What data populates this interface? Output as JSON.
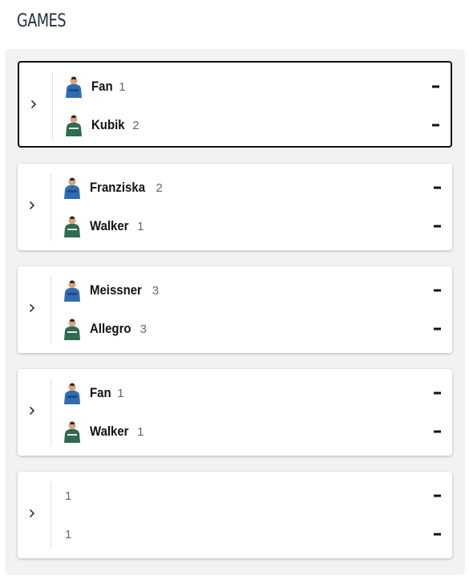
{
  "section": {
    "title": "GAMES"
  },
  "colors": {
    "team_blue": "#2f6db3",
    "team_green": "#2e6b4f"
  },
  "games": [
    {
      "selected": true,
      "home": {
        "name": "Fan",
        "rank": "1",
        "jersey": "blue"
      },
      "away": {
        "name": "Kubik",
        "rank": "2",
        "jersey": "green"
      }
    },
    {
      "selected": false,
      "home": {
        "name": "Franziska",
        "rank": "2",
        "jersey": "blue"
      },
      "away": {
        "name": "Walker",
        "rank": "1",
        "jersey": "green"
      }
    },
    {
      "selected": false,
      "home": {
        "name": "Meissner",
        "rank": "3",
        "jersey": "blue"
      },
      "away": {
        "name": "Allegro",
        "rank": "3",
        "jersey": "green"
      }
    },
    {
      "selected": false,
      "home": {
        "name": "Fan",
        "rank": "1",
        "jersey": "blue"
      },
      "away": {
        "name": "Walker",
        "rank": "1",
        "jersey": "green"
      }
    },
    {
      "selected": false,
      "home": {
        "name": "",
        "rank": "1",
        "jersey": ""
      },
      "away": {
        "name": "",
        "rank": "1",
        "jersey": ""
      }
    }
  ]
}
